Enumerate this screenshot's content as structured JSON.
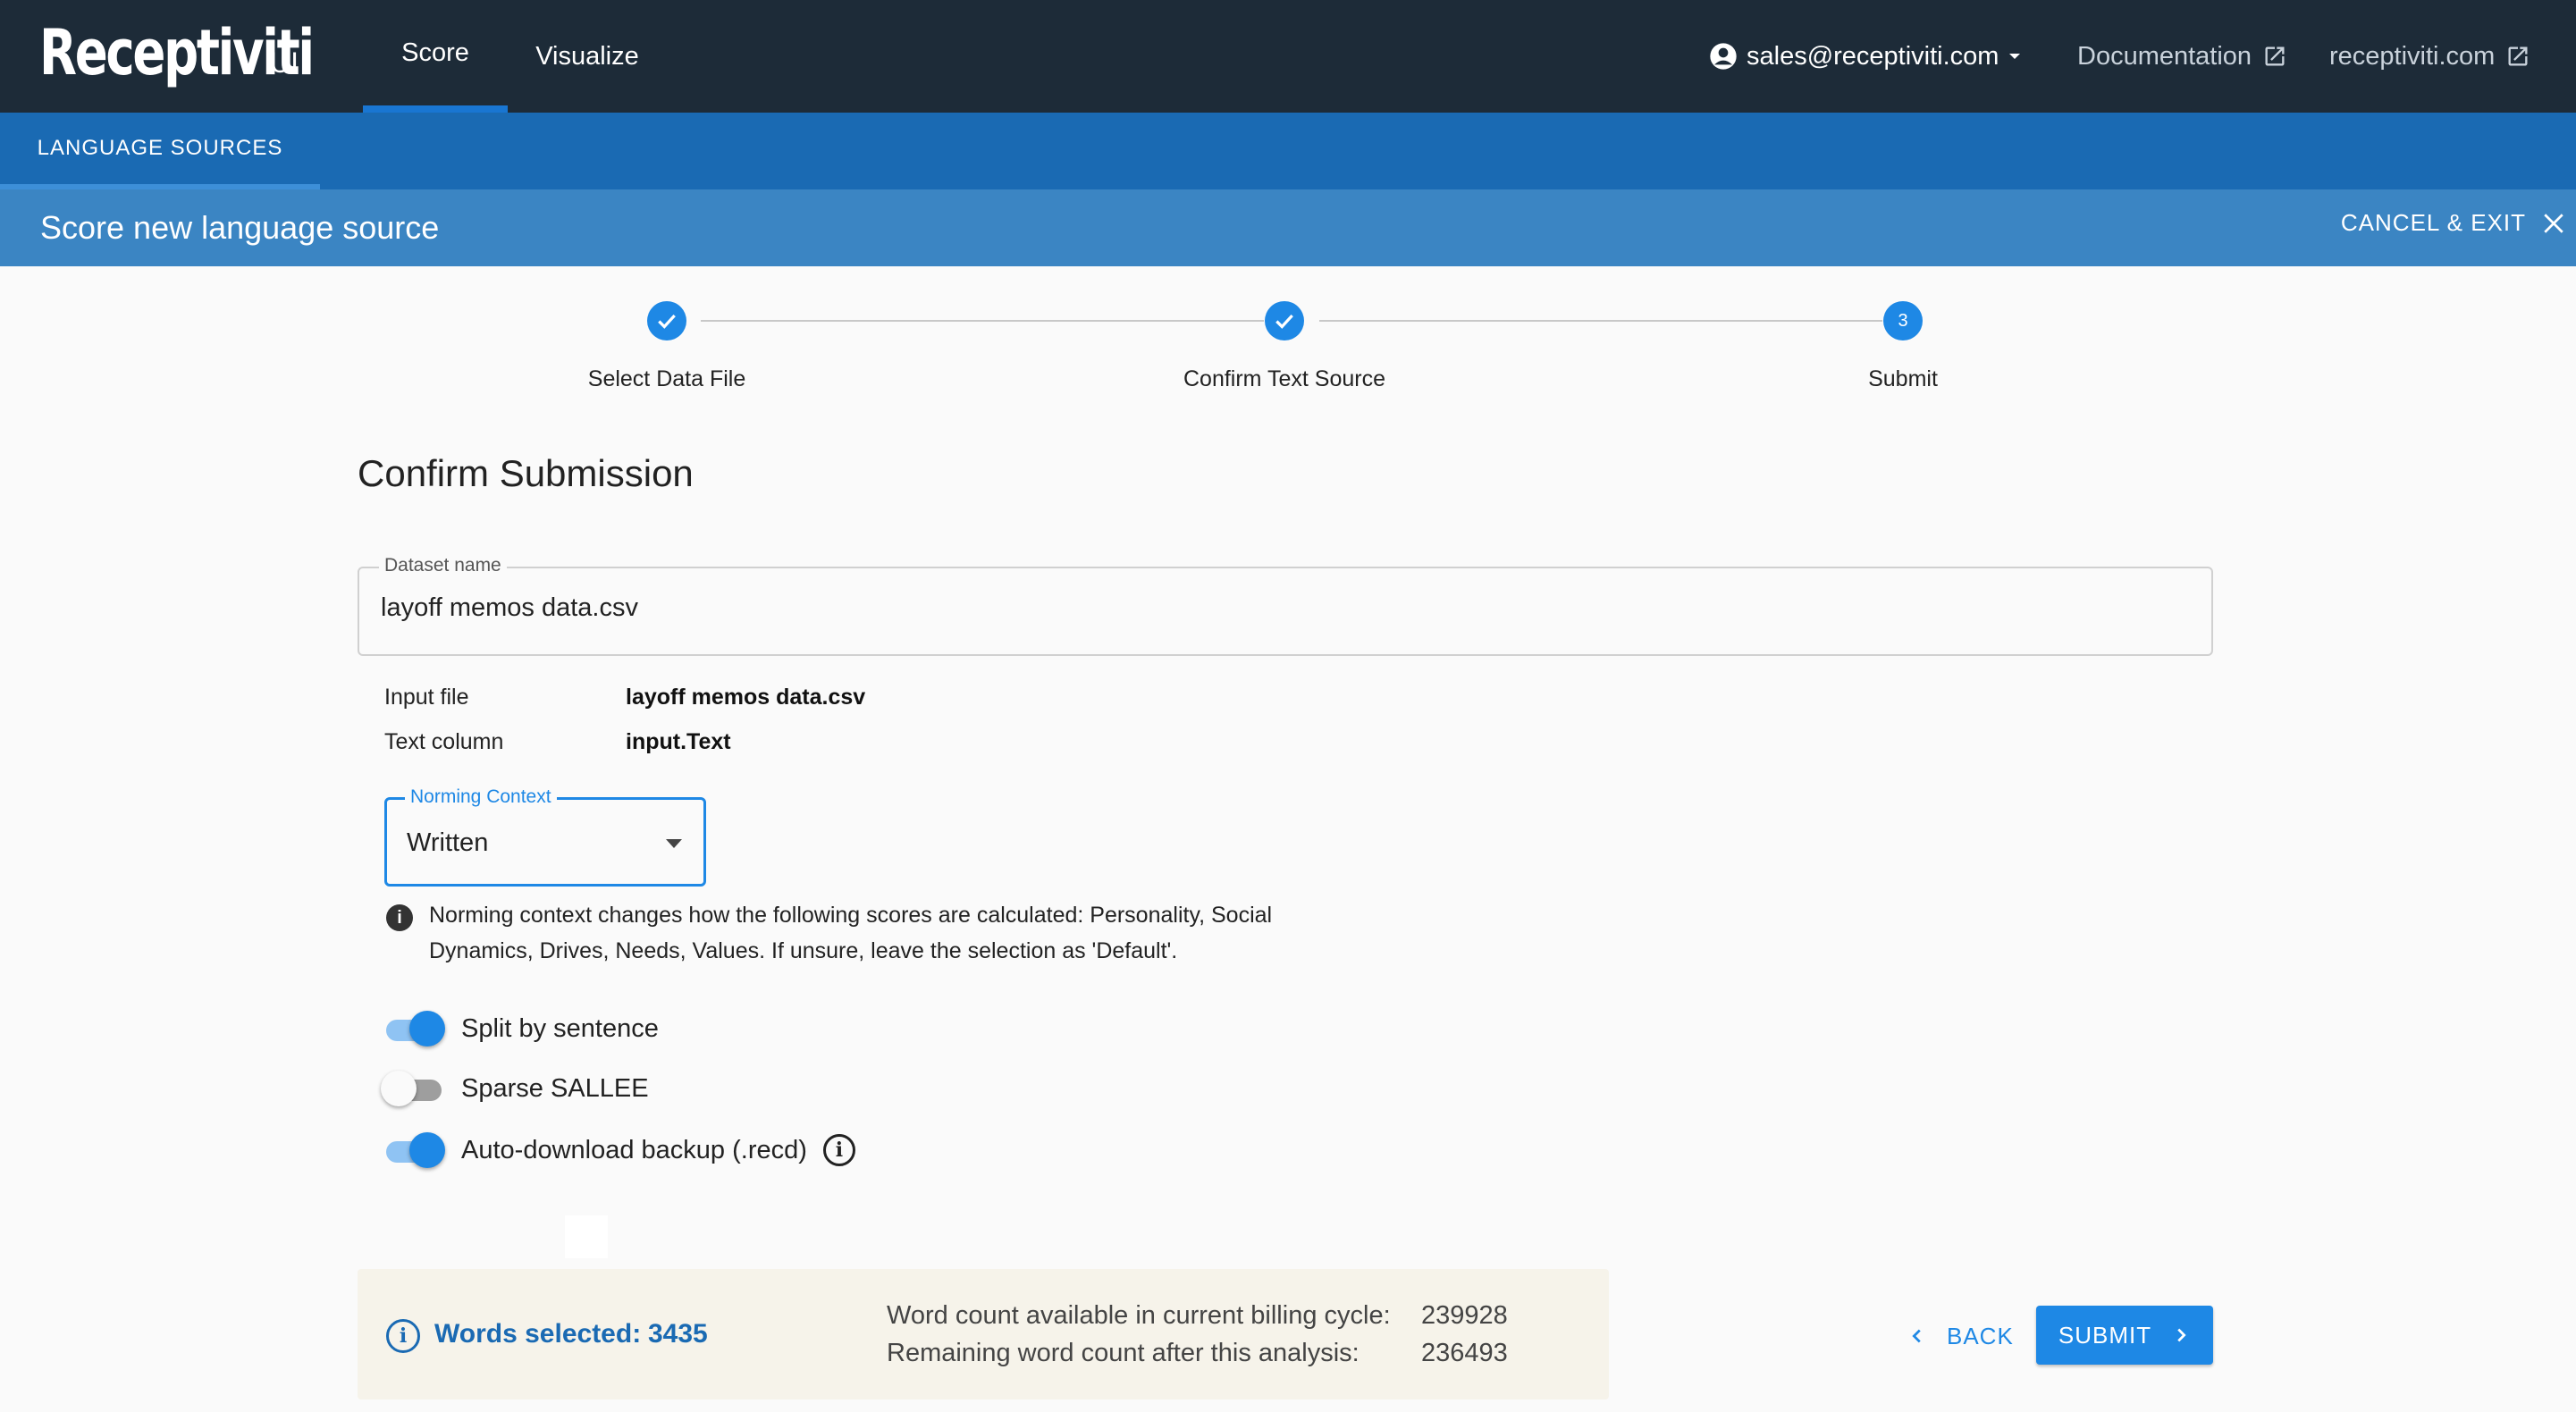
{
  "app": {
    "logo": "Receptiviti",
    "logo_suffix": "UI"
  },
  "nav": {
    "tabs": [
      {
        "label": "Score",
        "active": true
      },
      {
        "label": "Visualize",
        "active": false
      }
    ],
    "account": "sales@receptiviti.com",
    "documentation": "Documentation",
    "site": "receptiviti.com"
  },
  "subnav": {
    "tab": "LANGUAGE SOURCES"
  },
  "page": {
    "title": "Score new language source",
    "cancel": "CANCEL & EXIT"
  },
  "stepper": {
    "steps": [
      {
        "label": "Select Data File",
        "state": "complete",
        "number": "1"
      },
      {
        "label": "Confirm Text Source",
        "state": "complete",
        "number": "2"
      },
      {
        "label": "Submit",
        "state": "active",
        "number": "3"
      }
    ]
  },
  "form": {
    "section_title": "Confirm Submission",
    "dataset_name": {
      "label": "Dataset name",
      "value": "layoff memos data.csv"
    },
    "input_file": {
      "label": "Input file",
      "value": "layoff memos data.csv"
    },
    "text_column": {
      "label": "Text column",
      "value": "input.Text"
    },
    "norming_context": {
      "label": "Norming Context",
      "value": "Written"
    },
    "norming_note": "Norming context changes how the following scores are calculated: Personality, Social Dynamics, Drives, Needs, Values. If unsure, leave the selection as 'Default'.",
    "toggles": [
      {
        "label": "Split by sentence",
        "on": true
      },
      {
        "label": "Sparse SALLEE",
        "on": false
      },
      {
        "label": "Auto-download backup (.recd)",
        "on": true
      }
    ]
  },
  "summary": {
    "words_selected_label": "Words selected:",
    "words_selected_value": "3435",
    "available_label": "Word count available in current billing cycle:",
    "available_value": "239928",
    "remaining_label": "Remaining word count after this analysis:",
    "remaining_value": "236493"
  },
  "actions": {
    "back": "BACK",
    "submit": "SUBMIT"
  },
  "colors": {
    "topbar": "#1d2b38",
    "subbar": "#1a6ab3",
    "titlebar": "#3b85c3",
    "accent": "#1e88e5",
    "summary_bg": "#f6f3ea"
  }
}
